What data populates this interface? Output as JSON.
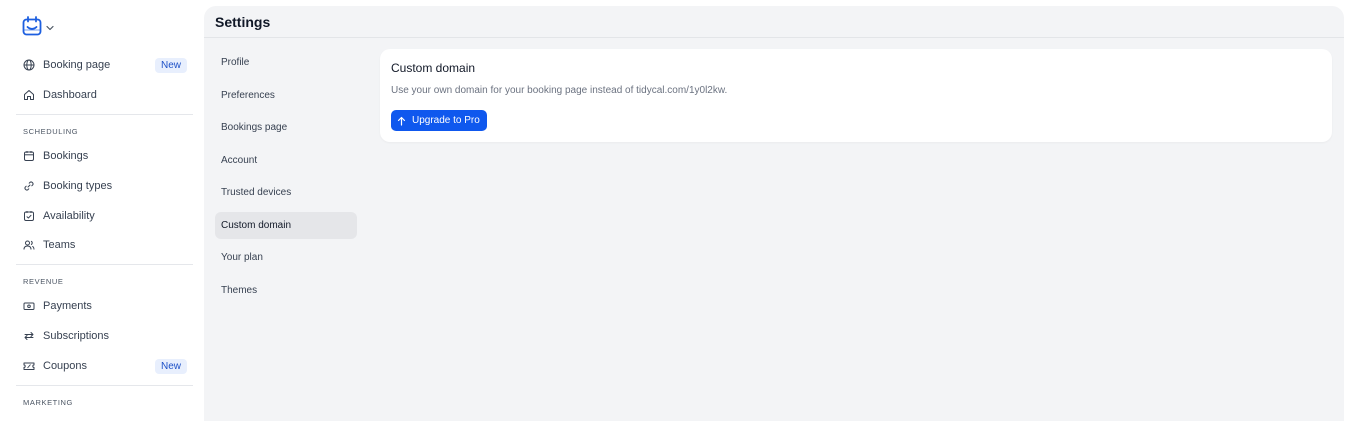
{
  "sidebar": {
    "logo_icon": "calendar-logo-icon",
    "primary": [
      {
        "label": "Booking page",
        "icon": "globe-icon",
        "badge": "New"
      },
      {
        "label": "Dashboard",
        "icon": "home-icon"
      }
    ],
    "scheduling": {
      "label": "SCHEDULING",
      "items": [
        {
          "label": "Bookings",
          "icon": "calendar-icon"
        },
        {
          "label": "Booking types",
          "icon": "link-icon"
        },
        {
          "label": "Availability",
          "icon": "calendar-check-icon"
        },
        {
          "label": "Teams",
          "icon": "users-icon"
        }
      ]
    },
    "revenue": {
      "label": "REVENUE",
      "items": [
        {
          "label": "Payments",
          "icon": "banknote-icon"
        },
        {
          "label": "Subscriptions",
          "icon": "repeat-icon"
        },
        {
          "label": "Coupons",
          "icon": "ticket-icon",
          "badge": "New"
        }
      ]
    },
    "marketing": {
      "label": "MARKETING"
    }
  },
  "main": {
    "title": "Settings",
    "menu": [
      {
        "label": "Profile"
      },
      {
        "label": "Preferences"
      },
      {
        "label": "Bookings page"
      },
      {
        "label": "Account"
      },
      {
        "label": "Trusted devices"
      },
      {
        "label": "Custom domain",
        "active": true
      },
      {
        "label": "Your plan"
      },
      {
        "label": "Themes"
      }
    ],
    "card": {
      "title": "Custom domain",
      "description": "Use your own domain for your booking page instead of tidycal.com/1y0l2kw.",
      "button_label": "Upgrade to Pro",
      "button_icon": "arrow-up-icon"
    }
  },
  "colors": {
    "accent": "#0f58ee",
    "badge_bg": "#e8effd",
    "badge_text": "#1e51c7",
    "panel_bg": "#f3f4f6",
    "active_item_bg": "#e5e6e9"
  }
}
